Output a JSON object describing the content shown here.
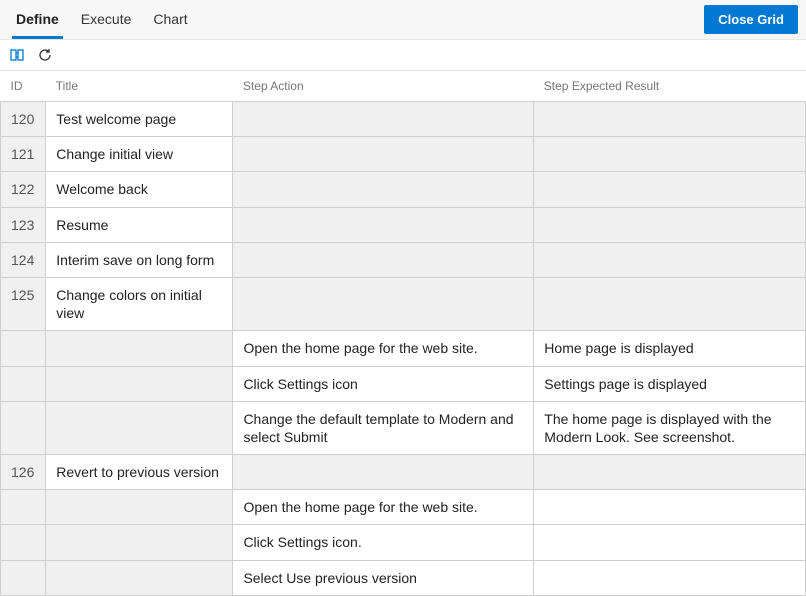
{
  "tabs": {
    "t0": "Define",
    "t1": "Execute",
    "t2": "Chart"
  },
  "buttons": {
    "close_grid": "Close Grid"
  },
  "columns": {
    "id": "ID",
    "title": "Title",
    "action": "Step Action",
    "result": "Step Expected Result"
  },
  "rows": [
    {
      "id": "120",
      "title": "Test welcome page",
      "action": "",
      "result": ""
    },
    {
      "id": "121",
      "title": "Change initial view",
      "action": "",
      "result": ""
    },
    {
      "id": "122",
      "title": "Welcome back",
      "action": "",
      "result": ""
    },
    {
      "id": "123",
      "title": "Resume",
      "action": "",
      "result": ""
    },
    {
      "id": "124",
      "title": "Interim save on long form",
      "action": "",
      "result": ""
    },
    {
      "id": "125",
      "title": "Change colors on initial view",
      "action": "",
      "result": ""
    },
    {
      "id": "",
      "title": "",
      "action": "Open the home page for the web site.",
      "result": "Home page is displayed"
    },
    {
      "id": "",
      "title": "",
      "action": "Click Settings icon",
      "result": "Settings page is displayed"
    },
    {
      "id": "",
      "title": "",
      "action": "Change the default template to Modern and select Submit",
      "result": "The home page is displayed with the Modern Look. See screenshot."
    },
    {
      "id": "126",
      "title": "Revert to previous version",
      "action": "",
      "result": ""
    },
    {
      "id": "",
      "title": "",
      "action": "Open the home page for the web site.",
      "result": ""
    },
    {
      "id": "",
      "title": "",
      "action": "Click Settings icon.",
      "result": ""
    },
    {
      "id": "",
      "title": "",
      "action": "Select Use previous version",
      "result": ""
    }
  ]
}
